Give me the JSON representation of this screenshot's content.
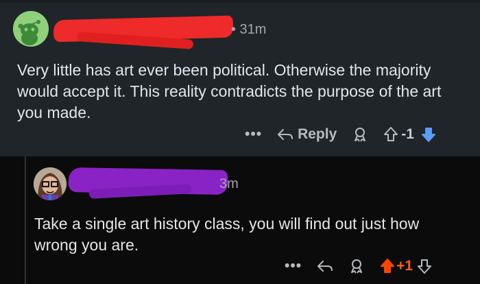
{
  "comments": [
    {
      "time": "• 31m",
      "text": "Very little has art ever been political. Otherwise the majority would accept it. This reality contradicts the purpose of the art you made.",
      "actions": {
        "more": "•••",
        "reply": "Reply",
        "score": "-1"
      },
      "colors": {
        "downvote": "#5b9cf5",
        "background": "#202529"
      }
    },
    {
      "time": "3m",
      "text": "Take a single art history class, you will find out just how wrong you are.",
      "actions": {
        "more": "•••",
        "score": "+1"
      },
      "colors": {
        "upvote": "#ff4500",
        "background": "#0b0b0b"
      }
    }
  ]
}
